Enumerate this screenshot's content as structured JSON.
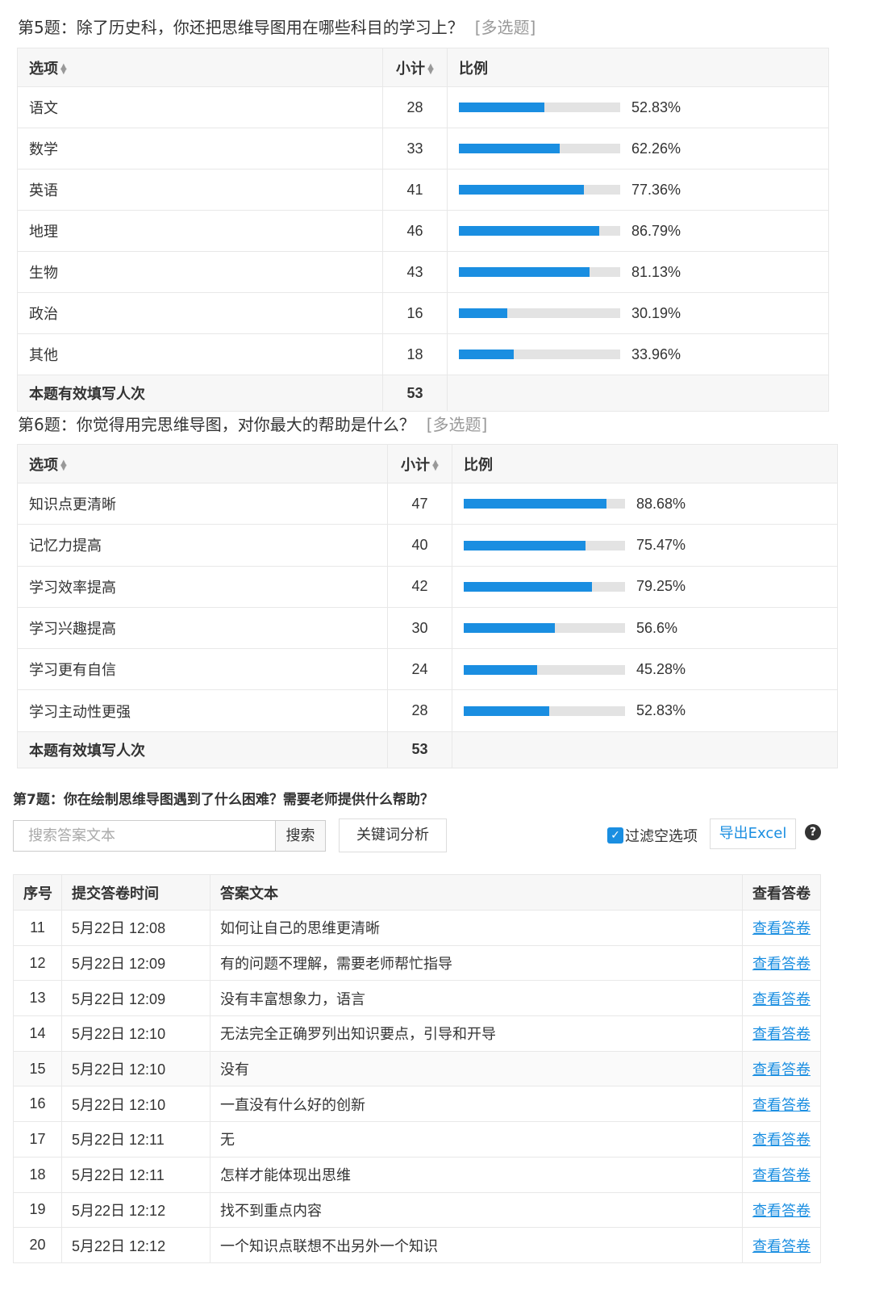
{
  "q5": {
    "title": "第5题：除了历史科，你还把思维导图用在哪些科目的学习上？",
    "tag": "[多选题]",
    "headers": {
      "option": "选项",
      "count": "小计",
      "ratio": "比例"
    },
    "rows": [
      {
        "option": "语文",
        "count": "28",
        "pct_label": "52.83%",
        "pct": 52.83
      },
      {
        "option": "数学",
        "count": "33",
        "pct_label": "62.26%",
        "pct": 62.26
      },
      {
        "option": "英语",
        "count": "41",
        "pct_label": "77.36%",
        "pct": 77.36
      },
      {
        "option": "地理",
        "count": "46",
        "pct_label": "86.79%",
        "pct": 86.79
      },
      {
        "option": "生物",
        "count": "43",
        "pct_label": "81.13%",
        "pct": 81.13
      },
      {
        "option": "政治",
        "count": "16",
        "pct_label": "30.19%",
        "pct": 30.19
      },
      {
        "option": "其他",
        "count": "18",
        "pct_label": "33.96%",
        "pct": 33.96
      }
    ],
    "total_label": "本题有效填写人次",
    "total": "53"
  },
  "q6": {
    "title": "第6题：你觉得用完思维导图，对你最大的帮助是什么？",
    "tag": "[多选题]",
    "headers": {
      "option": "选项",
      "count": "小计",
      "ratio": "比例"
    },
    "rows": [
      {
        "option": "知识点更清晰",
        "count": "47",
        "pct_label": "88.68%",
        "pct": 88.68
      },
      {
        "option": "记忆力提高",
        "count": "40",
        "pct_label": "75.47%",
        "pct": 75.47
      },
      {
        "option": "学习效率提高",
        "count": "42",
        "pct_label": "79.25%",
        "pct": 79.25
      },
      {
        "option": "学习兴趣提高",
        "count": "30",
        "pct_label": "56.6%",
        "pct": 56.6
      },
      {
        "option": "学习更有自信",
        "count": "24",
        "pct_label": "45.28%",
        "pct": 45.28
      },
      {
        "option": "学习主动性更强",
        "count": "28",
        "pct_label": "52.83%",
        "pct": 52.83
      }
    ],
    "total_label": "本题有效填写人次",
    "total": "53"
  },
  "q7": {
    "title": "第7题：你在绘制思维导图遇到了什么困难？需要老师提供什么帮助？",
    "search_placeholder": "搜索答案文本",
    "search_button": "搜索",
    "keyword_button": "关键词分析",
    "filter_label": "过滤空选项",
    "filter_checked": true,
    "export_button": "导出Excel",
    "help_icon": "?",
    "headers": {
      "num": "序号",
      "time": "提交答卷时间",
      "text": "答案文本",
      "view": "查看答卷"
    },
    "rows": [
      {
        "num": "11",
        "time": "5月22日 12:08",
        "text": "如何让自己的思维更清晰",
        "view": "查看答卷"
      },
      {
        "num": "12",
        "time": "5月22日 12:09",
        "text": "有的问题不理解，需要老师帮忙指导",
        "view": "查看答卷"
      },
      {
        "num": "13",
        "time": "5月22日 12:09",
        "text": "没有丰富想象力，语言",
        "view": "查看答卷"
      },
      {
        "num": "14",
        "time": "5月22日 12:10",
        "text": "无法完全正确罗列出知识要点，引导和开导",
        "view": "查看答卷"
      },
      {
        "num": "15",
        "time": "5月22日 12:10",
        "text": "没有",
        "view": "查看答卷"
      },
      {
        "num": "16",
        "time": "5月22日 12:10",
        "text": "一直没有什么好的创新",
        "view": "查看答卷"
      },
      {
        "num": "17",
        "time": "5月22日 12:11",
        "text": "无",
        "view": "查看答卷"
      },
      {
        "num": "18",
        "time": "5月22日 12:11",
        "text": "怎样才能体现出思维",
        "view": "查看答卷"
      },
      {
        "num": "19",
        "time": "5月22日 12:12",
        "text": "找不到重点内容",
        "view": "查看答卷"
      },
      {
        "num": "20",
        "time": "5月22日 12:12",
        "text": "一个知识点联想不出另外一个知识",
        "view": "查看答卷"
      }
    ]
  },
  "colors": {
    "bar_fill": "#1a8ee1",
    "bar_track": "#e3e3e3",
    "link": "#1a8ee1",
    "header_bg": "#f7f7f7"
  }
}
